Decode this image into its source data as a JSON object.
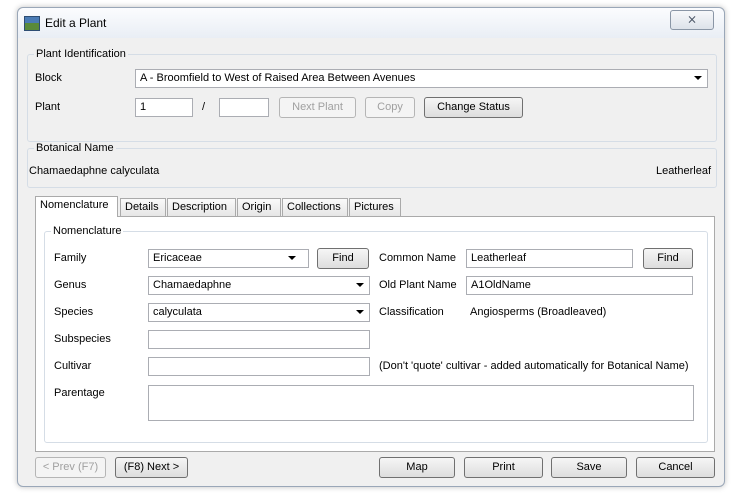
{
  "window": {
    "title": "Edit a Plant",
    "close_glyph": "⨯"
  },
  "plant_identification": {
    "legend": "Plant Identification",
    "block_label": "Block",
    "block_value": "A - Broomfield to West of Raised Area Between Avenues",
    "plant_label": "Plant",
    "plant_value": "1",
    "separator": "/",
    "plant_suffix_value": "",
    "next_plant_button": "Next Plant",
    "copy_button": "Copy",
    "change_status_button": "Change Status"
  },
  "botanical_name": {
    "legend": "Botanical Name",
    "value": "Chamaedaphne calyculata",
    "common": "Leatherleaf"
  },
  "tabs": [
    "Nomenclature",
    "Details",
    "Description",
    "Origin",
    "Collections",
    "Pictures"
  ],
  "nomenclature": {
    "legend": "Nomenclature",
    "family_label": "Family",
    "family_value": "Ericaceae",
    "family_find": "Find",
    "genus_label": "Genus",
    "genus_value": "Chamaedaphne",
    "species_label": "Species",
    "species_value": "calyculata",
    "subspecies_label": "Subspecies",
    "subspecies_value": "",
    "cultivar_label": "Cultivar",
    "cultivar_value": "",
    "parentage_label": "Parentage",
    "parentage_value": "",
    "common_name_label": "Common Name",
    "common_name_value": "Leatherleaf",
    "common_find": "Find",
    "old_plant_name_label": "Old Plant Name",
    "old_plant_name_value": "A1OldName",
    "classification_label": "Classification",
    "classification_value": "Angiosperms (Broadleaved)",
    "cultivar_note": "(Don't 'quote' cultivar - added automatically for Botanical Name)"
  },
  "footer": {
    "prev": "< Prev (F7)",
    "next": "(F8) Next >",
    "map": "Map",
    "print": "Print",
    "save": "Save",
    "cancel": "Cancel"
  }
}
